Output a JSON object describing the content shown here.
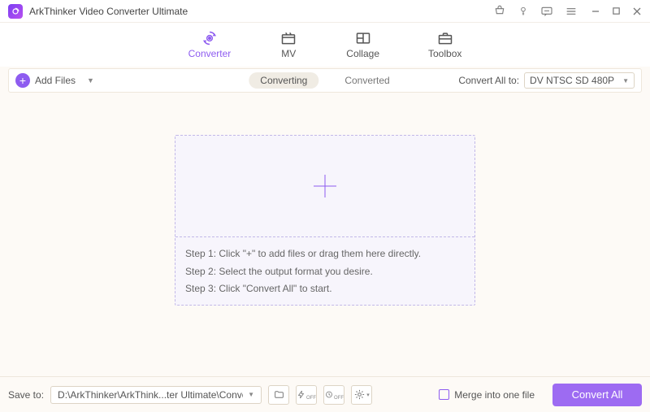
{
  "titlebar": {
    "title": "ArkThinker Video Converter Ultimate"
  },
  "tabs": {
    "converter": "Converter",
    "mv": "MV",
    "collage": "Collage",
    "toolbox": "Toolbox"
  },
  "toolbar": {
    "add_files": "Add Files",
    "converting": "Converting",
    "converted": "Converted",
    "convert_all_to": "Convert All to:",
    "format": "DV NTSC SD 480P"
  },
  "steps": {
    "s1": "Step 1: Click \"+\" to add files or drag them here directly.",
    "s2": "Step 2: Select the output format you desire.",
    "s3": "Step 3: Click \"Convert All\" to start."
  },
  "footer": {
    "save_to_label": "Save to:",
    "save_path": "D:\\ArkThinker\\ArkThink...ter Ultimate\\Converted",
    "merge_label": "Merge into one file",
    "convert_all": "Convert All"
  }
}
